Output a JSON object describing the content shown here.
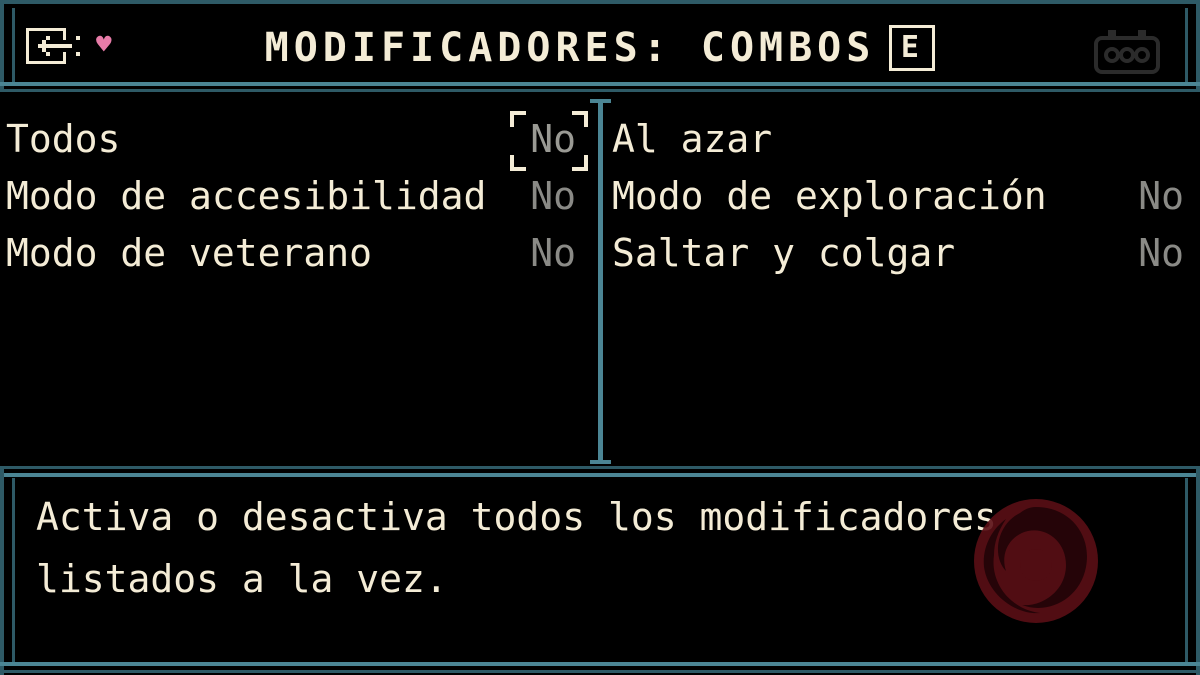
{
  "header": {
    "title": "MODIFICADORES: COMBOS",
    "tab_key": "E",
    "back_icon": "back-arrow-icon",
    "heart_icon": "heart-icon",
    "controller_icon": "gamepad-icon"
  },
  "left_options": [
    {
      "label": "Todos",
      "value": "No",
      "selected": true
    },
    {
      "label": "Modo de accesibilidad",
      "value": "No",
      "selected": false
    },
    {
      "label": "Modo de veterano",
      "value": "No",
      "selected": false
    }
  ],
  "right_options": [
    {
      "label": "Al azar",
      "value": "",
      "selected": false
    },
    {
      "label": "Modo de exploración",
      "value": "No",
      "selected": false
    },
    {
      "label": "Saltar y colgar",
      "value": "No",
      "selected": false
    }
  ],
  "description": {
    "line1": "Activa o desactiva todos los modificadores",
    "line2": "listados a la vez."
  },
  "colors": {
    "frame": "#2e5a66",
    "frame_light": "#4b8594",
    "text": "#f4ecd6",
    "value_text": "#8a8a86",
    "heart": "#e77ca8",
    "watermark": "#7a1a22"
  }
}
